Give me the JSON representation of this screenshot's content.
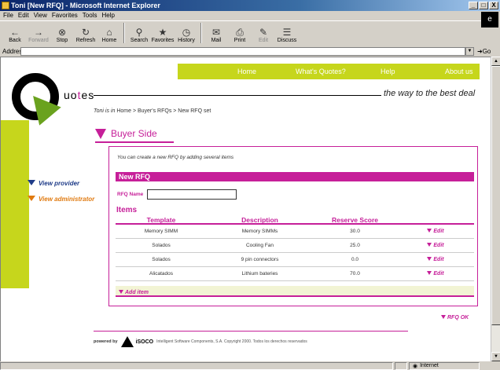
{
  "window": {
    "title": "Toni [New RFQ] - Microsoft Internet Explorer",
    "controls": [
      "_",
      "□",
      "X"
    ]
  },
  "menu": [
    "File",
    "Edit",
    "View",
    "Favorites",
    "Tools",
    "Help"
  ],
  "toolbar": [
    {
      "label": "Back",
      "icon": "←"
    },
    {
      "label": "Forward",
      "icon": "→"
    },
    {
      "label": "Stop",
      "icon": "⊗"
    },
    {
      "label": "Refresh",
      "icon": "↻"
    },
    {
      "label": "Home",
      "icon": "⌂"
    },
    {
      "label": "Search",
      "icon": "⚲"
    },
    {
      "label": "Favorites",
      "icon": "★"
    },
    {
      "label": "History",
      "icon": "◷"
    },
    {
      "label": "Mail",
      "icon": "✉"
    },
    {
      "label": "Print",
      "icon": "⎙"
    },
    {
      "label": "Edit",
      "icon": "✎"
    },
    {
      "label": "Discuss",
      "icon": "☰"
    }
  ],
  "address": {
    "label": "Address",
    "go_label": "Go",
    "value": ""
  },
  "nav": {
    "home": "Home",
    "whats_quotes": "What's Quotes?",
    "help": "Help",
    "about": "About us"
  },
  "logo": {
    "prefix": "uo",
    "accent": "t",
    "suffix": "es"
  },
  "tagline": "the way to the best deal",
  "breadcrumb": {
    "user": "Toni is in",
    "path": "Home > Buyer's RFQs > New RFQ set"
  },
  "sidebar": {
    "provider": "View provider",
    "administrator": "View administrator"
  },
  "section": {
    "title": "Buyer Side"
  },
  "intro": "You can create a new RFQ by adding several items",
  "form": {
    "title": "New RFQ",
    "rfq_name_label": "RFQ Name",
    "rfq_name_value": ""
  },
  "items": {
    "heading": "Items",
    "columns": [
      "Template",
      "Description",
      "Reserve Score",
      ""
    ],
    "rows": [
      {
        "template": "Memory SIMM",
        "description": "Memory SIMMs",
        "score": "30.0",
        "action": "Edit"
      },
      {
        "template": "Solados",
        "description": "Cooling Fan",
        "score": "25.0",
        "action": "Edit"
      },
      {
        "template": "Solados",
        "description": "9 pin connectors",
        "score": "0.0",
        "action": "Edit"
      },
      {
        "template": "Alicatados",
        "description": "Lithium bateries",
        "score": "70.0",
        "action": "Edit"
      }
    ],
    "add_label": "Add item"
  },
  "rfq_ok": "RFQ OK",
  "footer": {
    "powered_by": "powered by",
    "company": "iSOCO",
    "text": "Intelligent Software Components, S.A. Copyright 2000. Todos los derechos reservados"
  },
  "status": {
    "text": "",
    "zone": "Internet"
  },
  "colors": {
    "accent": "#c61f99",
    "lime": "#c6d61c",
    "logo_arrow": "#6aa21e",
    "provider_link": "#1f3c88",
    "admin_link": "#e07a10"
  }
}
